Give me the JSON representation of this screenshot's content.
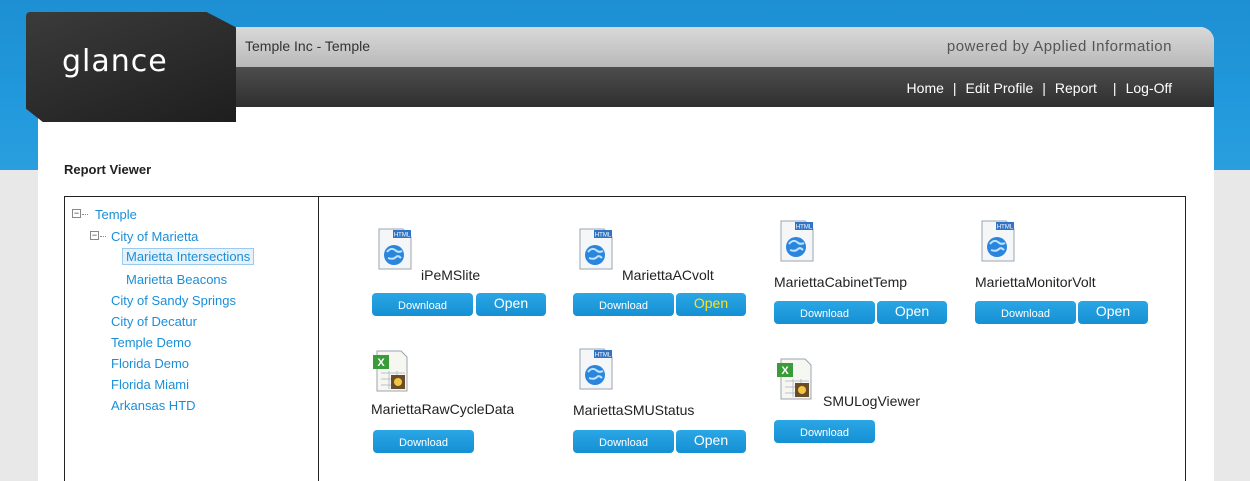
{
  "app": {
    "logo": "glance",
    "org_title": "Temple Inc - Temple",
    "powered_by": "powered by Applied Information"
  },
  "nav": {
    "home": "Home",
    "edit_profile": "Edit Profile",
    "report": "Report",
    "logoff": "Log-Off",
    "separator": "|"
  },
  "section_title": "Report Viewer",
  "tree": {
    "root": "Temple",
    "expanded_child": "City of Marietta",
    "marietta_children": [
      "Marietta Intersections",
      "Marietta Beacons"
    ],
    "selected": "Marietta Intersections",
    "siblings": [
      "City of Sandy Springs",
      "City of Decatur",
      "Temple Demo",
      "Florida Demo",
      "Florida Miami",
      "Arkansas HTD"
    ]
  },
  "buttons": {
    "download": "Download",
    "open": "Open"
  },
  "reports": [
    {
      "name": "iPeMSlite",
      "icon": "html-globe-icon",
      "has_open": true
    },
    {
      "name": "MariettaACvolt",
      "icon": "html-globe-icon",
      "has_open": true
    },
    {
      "name": "MariettaCabinetTemp",
      "icon": "html-globe-icon",
      "has_open": true
    },
    {
      "name": "MariettaMonitorVolt",
      "icon": "html-globe-icon",
      "has_open": true
    },
    {
      "name": "MariettaRawCycleData",
      "icon": "excel-icon",
      "has_open": false
    },
    {
      "name": "MariettaSMUStatus",
      "icon": "html-globe-icon",
      "has_open": true
    },
    {
      "name": "SMULogViewer",
      "icon": "excel-icon",
      "has_open": false
    }
  ],
  "colors": {
    "brand_blue": "#1e8fd3",
    "link_blue": "#1a8fd8",
    "button_blue": "#1590d3",
    "highlight_open_text": "#ffe11a",
    "header_dark": "#2f2f2f"
  }
}
